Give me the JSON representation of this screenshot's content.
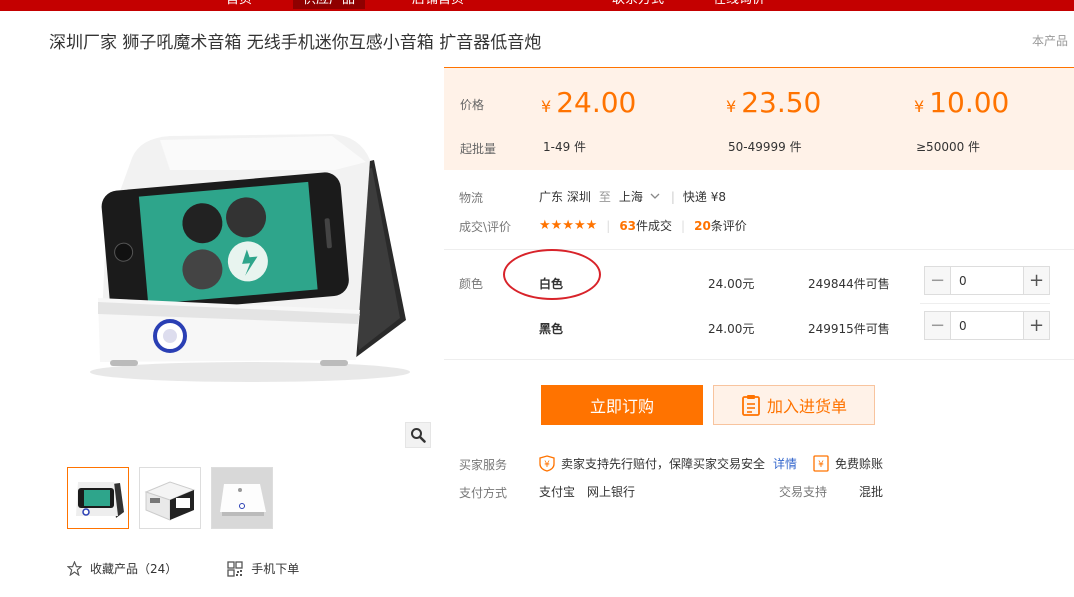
{
  "nav": {
    "items": [
      "首页",
      "供应产品",
      "店铺首页",
      "联系方式",
      "在线询价"
    ]
  },
  "product": {
    "title": "深圳厂家 狮子吼魔术音箱 无线手机迷你互感小音箱 扩音器低音炮",
    "title_right": "本产品"
  },
  "price_panel": {
    "price_label": "价格",
    "moq_label": "起批量",
    "currency": "¥",
    "tiers": [
      {
        "price": "24.00",
        "qty": "1-49 件"
      },
      {
        "price": "23.50",
        "qty": "50-49999 件"
      },
      {
        "price": "10.00",
        "qty": "≥50000 件"
      }
    ]
  },
  "logistics": {
    "label": "物流",
    "from": "广东 深圳",
    "to_word": "至",
    "to": "上海",
    "express": "快递 ¥8"
  },
  "reviews": {
    "label": "成交\\评价",
    "stars": "★★★★★",
    "deals_count": "63",
    "deals_suffix": "件成交",
    "review_count": "20",
    "review_suffix": "条评价"
  },
  "sku": {
    "label": "颜色",
    "rows": [
      {
        "name": "白色",
        "price": "24.00元",
        "stock": "249844件可售",
        "qty": "0"
      },
      {
        "name": "黑色",
        "price": "24.00元",
        "stock": "249915件可售",
        "qty": "0"
      }
    ]
  },
  "actions": {
    "order": "立即订购",
    "cart": "加入进货单"
  },
  "service": {
    "label": "买家服务",
    "guarantee": "卖家支持先行赔付，保障买家交易安全",
    "details": "详情",
    "free_account": "免费赊账"
  },
  "payment": {
    "label": "支付方式",
    "methods": [
      "支付宝",
      "网上银行"
    ],
    "trade_label": "交易支持",
    "trade_value": "混批"
  },
  "bottom": {
    "favorite": "收藏产品（24）",
    "mobile": "手机下单"
  },
  "colors": {
    "accent": "#ff7300",
    "nav_red": "#c40000",
    "annotation_red": "#d8232a"
  }
}
